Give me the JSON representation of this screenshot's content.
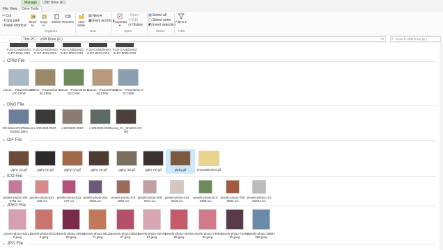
{
  "window": {
    "title": "USB Drive (E:)",
    "context_tab": "Manage"
  },
  "ribbon": {
    "tabs": [
      "File",
      "View",
      "Drive Tools"
    ],
    "clipboard": {
      "cut": "Cut",
      "copy_path": "Copy path",
      "paste_shortcut": "Paste shortcut",
      "move_to": "Move to",
      "copy_to": "Copy to",
      "group": "Organize"
    },
    "organize": {
      "delete": "Delete",
      "rename": "Rename"
    },
    "new": {
      "new_folder": "New folder",
      "new_item": "New",
      "easy_access": "Easy access",
      "group": "New"
    },
    "open": {
      "properties": "Properties",
      "open": "Open",
      "edit": "Edit",
      "history": "History",
      "group": "Open"
    },
    "select": {
      "select_all": "Select all",
      "select_none": "Select none",
      "invert": "Invert selection",
      "group": "Select"
    },
    "filter": {
      "label": "Filters",
      "group": "Filter"
    }
  },
  "address": {
    "crumbs": [
      "This PC",
      "USB Drive (E:)"
    ],
    "search_placeholder": "Search USB Drive (E:)"
  },
  "groups": {
    "top_row": [
      {
        "name": "Y-JG-CANON-EOS-R7-0011.CR3"
      },
      {
        "name": "Y-JG-CANON-EOS-R7-0012.CR3"
      },
      {
        "name": "Y-JG-CANON-EOS-R7-0010.CR3"
      },
      {
        "name": "Y-JG-CANON-EOS-R7-0013.CR3"
      },
      {
        "name": "Y-JG-CANON-EOS-R7-0005.CR3"
      }
    ],
    "crw": {
      "label": "CRW File",
      "items": [
        {
          "name": "Canon - PowerShot Pro70.CRW",
          "color": "#a9b9c6"
        },
        {
          "name": "Canon - PowerShot S30.CRW",
          "color": "#9a8a6a"
        },
        {
          "name": "Canon - PowerShot S50.CRW",
          "color": "#6f8a5a"
        },
        {
          "name": "Canon - PowerShot S60.CRW",
          "color": "#b79a7d"
        },
        {
          "name": "Canon - PowerShot S70.CRW",
          "color": "#8c9fb2"
        }
      ]
    },
    "dng": {
      "label": "DNG File",
      "items": [
        {
          "name": "DV-MacroProPlatinum-ShotKit.DNG",
          "color": "#6c7f99"
        },
        {
          "name": "L1001634.DNG",
          "color": "#3a3a3a"
        },
        {
          "name": "L1001905.DNG",
          "color": "#8b7b70"
        },
        {
          "name": "L1001920.DNG",
          "color": "#5e6a66"
        },
        {
          "name": "Leica_CL_ShotKit-2.DNG",
          "color": "#4a3f3a"
        }
      ]
    },
    "gif": {
      "label": "GIF File",
      "items": [
        {
          "name": "giphy (1).gif",
          "color": "#6b4a3a"
        },
        {
          "name": "giphy (2).gif",
          "color": "#2f2a2a"
        },
        {
          "name": "giphy (3).gif",
          "color": "#a06a4a"
        },
        {
          "name": "giphy (4).gif",
          "color": "#4b3b33"
        },
        {
          "name": "giphy (5).gif",
          "color": "#7a7060"
        },
        {
          "name": "giphy (6).gif",
          "color": "#3a3030"
        },
        {
          "name": "giphy.gif",
          "color": "#7b5a40"
        },
        {
          "name": "tinycatstickers.gif",
          "color": "#e8d48a"
        }
      ]
    },
    "ico": {
      "label": "ICO File",
      "items": [
        {
          "name": "pexels-photo-1906791.ico",
          "color": "#c27a9b"
        },
        {
          "name": "pexels-photo-831190.ico",
          "color": "#d98a8a"
        },
        {
          "name": "pexels-photo-831177.ico",
          "color": "#b3507a"
        },
        {
          "name": "pexels-photo-2534526.ico",
          "color": "#6a5a7a"
        },
        {
          "name": "pexels-photo-2784091.ico",
          "color": "#9a6a5a"
        },
        {
          "name": "pexels-photo-4080011.ico",
          "color": "#c0a0a0"
        },
        {
          "name": "pexels-photo-4233349.ico",
          "color": "#d6c6c0"
        },
        {
          "name": "pexels-photo-5103308.ico",
          "color": "#6d8a5a"
        },
        {
          "name": "pexels-photo-7909034.ico",
          "color": "#a25a40"
        },
        {
          "name": "pexels-photo-17302404.ico",
          "color": "#bcbcbc"
        }
      ]
    },
    "jpeg": {
      "label": "JPEG File",
      "items": [
        {
          "name": "pexels-photo-831175.jpeg",
          "color": "#d7a0b0"
        },
        {
          "name": "pexels-photo-831176.jpeg",
          "color": "#c8756f"
        },
        {
          "name": "pexels-photo-2891068.jpeg",
          "color": "#7a2a4a"
        },
        {
          "name": "pexels-photo-2912871.jpeg",
          "color": "#c07a5a"
        },
        {
          "name": "pexels-photo-3842327.jpeg",
          "color": "#b4506a"
        },
        {
          "name": "pexels-photo-4207997.jpeg",
          "color": "#d8a6b4"
        },
        {
          "name": "pexels-photo-4075866.jpeg",
          "color": "#c45a6a"
        },
        {
          "name": "pexels-photo-7359405.jpeg",
          "color": "#d07a8a"
        },
        {
          "name": "pexels-photo-7529405.jpeg",
          "color": "#5a3a4a"
        },
        {
          "name": "pexels-photo-16887058.jpeg",
          "color": "#6a8aaa"
        }
      ]
    },
    "jpg": {
      "label": "JPG File"
    }
  },
  "colors": {
    "accent": "#0067c0",
    "selection": "#cce8ff",
    "manage_tab": "#cfe8c8"
  }
}
